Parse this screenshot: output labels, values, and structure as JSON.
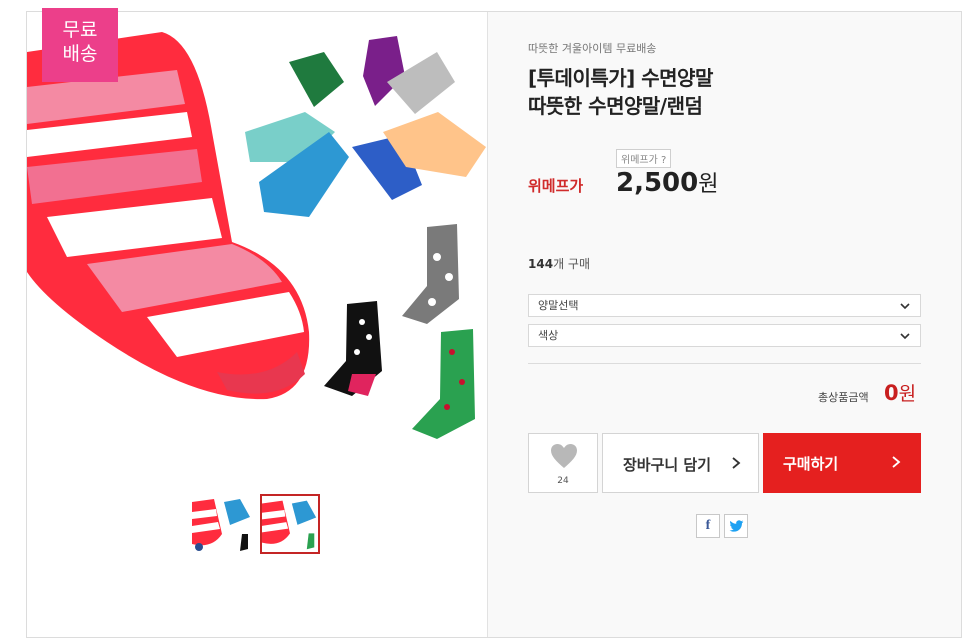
{
  "badge": {
    "free_shipping": "무료\n배송"
  },
  "product": {
    "subtitle": "따뜻한 겨울아이템 무료배송",
    "title_line1": "[투데이특가] 수면양말",
    "title_line2": "따뜻한 수면양말/랜덤",
    "price_info_chip": "위메프가 ?",
    "price_label": "위메프가",
    "price_number": "2,500",
    "price_unit": "원",
    "buy_count_number": "144",
    "buy_count_suffix": "개 구매"
  },
  "options": {
    "select1_label": "양말선택",
    "select2_label": "색상"
  },
  "total": {
    "label": "총상품금액",
    "value": "0",
    "unit": "원"
  },
  "actions": {
    "wish_count": "24",
    "cart_label": "장바구니 담기",
    "buy_label": "구매하기"
  },
  "colors": {
    "badge_pink": "#ec3f8a",
    "buy_red": "#e5201f",
    "price_red": "#d02b2b",
    "total_red": "#c81f1f",
    "facebook_blue": "#3b5998",
    "twitter_blue": "#1da1f2"
  },
  "icons": {
    "wish": "heart-icon",
    "select_arrow": "chevron-down-icon",
    "cart_arrow": "chevron-right-icon",
    "buy_arrow": "chevron-right-icon",
    "facebook": "facebook-icon",
    "twitter": "twitter-icon"
  }
}
